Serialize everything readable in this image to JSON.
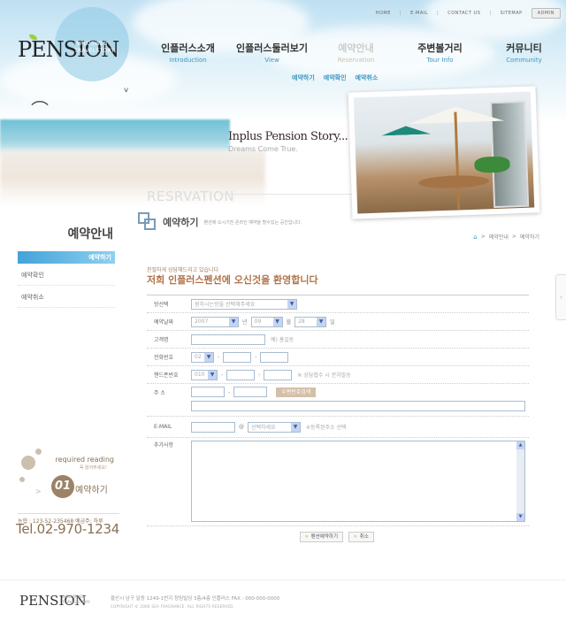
{
  "brand": {
    "logo": "PENSION",
    "tagline_1": "INPLUSWEB",
    "tagline_2": "TRAVELSTORY"
  },
  "top_nav": {
    "items": [
      "HOME",
      "E-MAIL",
      "CONTACT US",
      "SITEMAP"
    ],
    "admin": "ADMIN"
  },
  "gnb": [
    {
      "ko": "인플러스소개",
      "en": "Introduction"
    },
    {
      "ko": "인플러스둘러보기",
      "en": "View"
    },
    {
      "ko": "예약안내",
      "en": "Reservation",
      "active": true
    },
    {
      "ko": "주변볼거리",
      "en": "Tour Info"
    },
    {
      "ko": "커뮤니티",
      "en": "Community"
    }
  ],
  "subnav": [
    "예약하기",
    "예약확인",
    "예약취소"
  ],
  "hero": {
    "story_title": "Inplus Pension Story...",
    "story_sub": "Dreams Come True.",
    "section_en": "RESRVATION"
  },
  "sidebar": {
    "title": "예약안내",
    "items": [
      {
        "label": "예약하기",
        "active": true
      },
      {
        "label": "예약확인"
      },
      {
        "label": "예약취소"
      }
    ],
    "required": {
      "title": "required reading",
      "sub": "꼭 읽어주세요!",
      "num": "01",
      "label": "예약하기"
    },
    "account": "농협 : 123-52-235468  예금주: 하루",
    "tel": "Tel.02-970-1234"
  },
  "page": {
    "title": "예약하기",
    "desc": "펜션에 오시기전 온라인 예약을 할수있는 공간입니다.",
    "breadcrumb": [
      "예약안내",
      "예약하기"
    ]
  },
  "welcome": {
    "small": "친절하게 상담해드리고 있습니다",
    "big": "저희 인플러스펜션에 오신것을 환영합니다"
  },
  "form": {
    "room": {
      "label": "방선택",
      "value": "원하시는방을 선택해주세요"
    },
    "date": {
      "label": "예약날짜",
      "year": "2007",
      "year_unit": "년",
      "month": "09",
      "month_unit": "월",
      "day": "28",
      "day_unit": "일"
    },
    "name": {
      "label": "고객명",
      "value": "",
      "hint": "예) 홍길동"
    },
    "phone": {
      "label": "전화번호",
      "prefix": "02",
      "mid": "",
      "last": ""
    },
    "mobile": {
      "label": "핸드폰번호",
      "prefix": "010",
      "mid": "",
      "last": "",
      "note": "※ 상담접수 시 문자발송"
    },
    "address": {
      "label": "주 소",
      "zip1": "",
      "zip2": "",
      "zip_button": "우편번호검색",
      "detail": ""
    },
    "email": {
      "label": "E-MAIL",
      "id": "",
      "at": "@",
      "domain": "선택하세요",
      "note": "※등록된주소 선택"
    },
    "memo": {
      "label": "추가사항",
      "value": ""
    }
  },
  "buttons": {
    "submit": "펜션예약하기",
    "cancel": "취소"
  },
  "footer": {
    "address": "울산시 남구 달동 1249-1번지 청림빌딩 3층/4층 인플러스  FAX : 000-000-0000",
    "copyright": "COPYRIGHT © 2006 SEA FRAGRANCE. ALL RIGHTS RESERVED."
  }
}
